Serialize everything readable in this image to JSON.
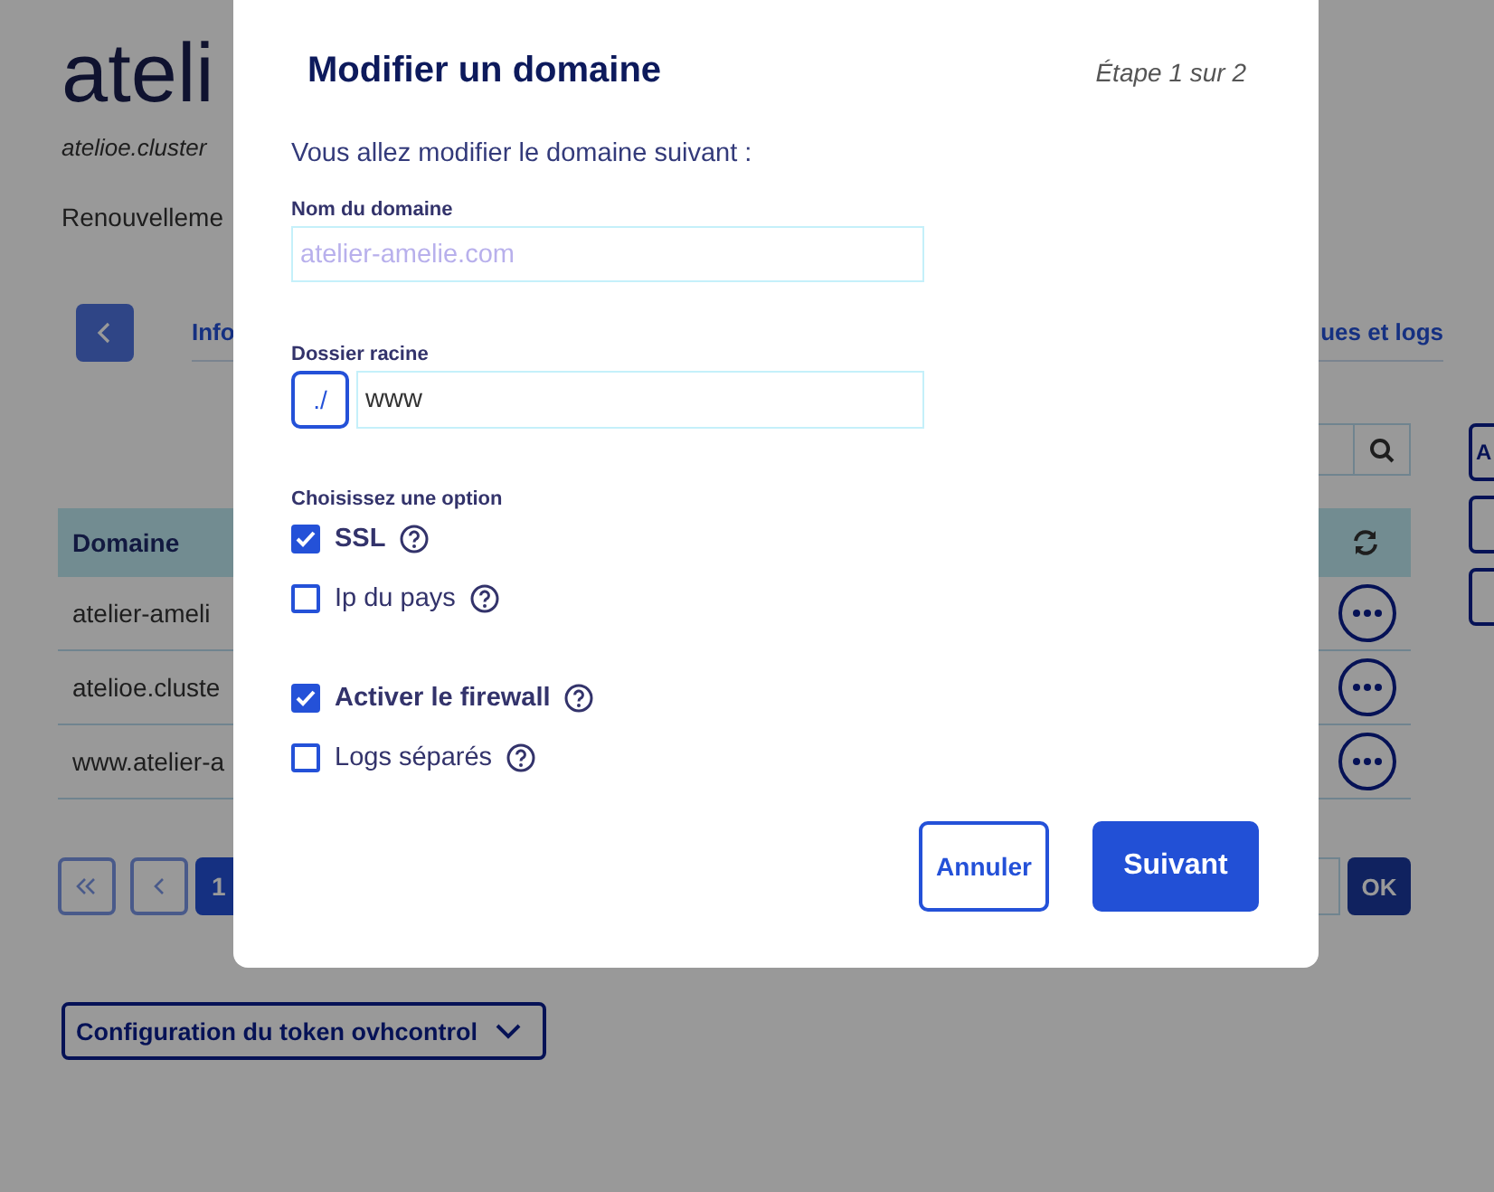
{
  "page": {
    "title": "ateli",
    "subtitle": "atelioe.cluster",
    "renewal": "Renouvelleme"
  },
  "tabs": [
    "Info",
    "ues et logs"
  ],
  "side_buttons": [
    {
      "kind": "text",
      "label": "A"
    },
    {
      "kind": "blank"
    },
    {
      "kind": "blank"
    }
  ],
  "table": {
    "columns": [
      "Domaine"
    ],
    "rows": [
      "atelier-ameli",
      "atelioe.cluste",
      "www.atelier-a"
    ]
  },
  "pagination": {
    "pages": [
      "1"
    ],
    "go": "OK"
  },
  "config_button": "Configuration du token ovhcontrol",
  "dialog": {
    "title": "Modifier un domaine",
    "step": "Étape 1 sur 2",
    "intro": "Vous allez modifier le domaine suivant :",
    "domain_label": "Nom du domaine",
    "domain_value": "atelier-amelie.com",
    "folder_label": "Dossier racine",
    "folder_prefix": "./",
    "folder_value": "www",
    "options_label": "Choisissez une option",
    "option_groups": [
      {
        "options": [
          {
            "label": "SSL",
            "checked": true
          },
          {
            "label": "Ip du pays",
            "checked": false
          }
        ]
      },
      {
        "options": [
          {
            "label": "Activer le firewall",
            "checked": true
          },
          {
            "label": "Logs séparés",
            "checked": false
          }
        ]
      }
    ],
    "buttons": [
      {
        "kind": "secondary",
        "label": "Annuler"
      },
      {
        "kind": "primary",
        "label": "Suivant"
      }
    ]
  }
}
